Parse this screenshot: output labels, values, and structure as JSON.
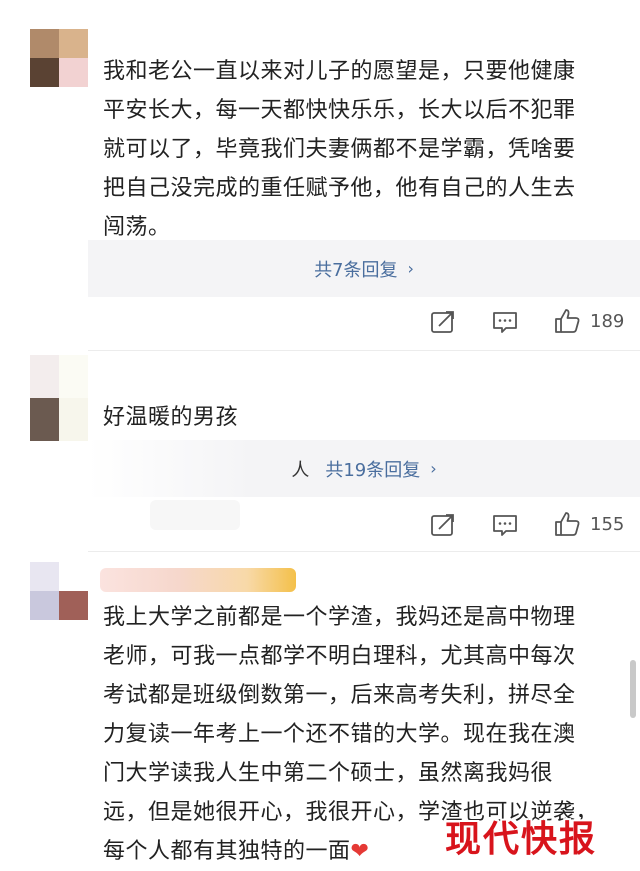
{
  "comments": [
    {
      "text": "我和老公一直以来对儿子的愿望是，只要他健康平安长大，每一天都快快乐乐，长大以后不犯罪就可以了，毕竟我们夫妻俩都不是学霸，凭啥要把自己没完成的重任赋予他，他有自己的人生去闯荡。",
      "lines": [
        "我和老公一直以来对儿子的愿望是，只要他健康",
        "平安长大，每一天都快快乐乐，长大以后不犯罪",
        "就可以了，毕竟我们夫妻俩都不是学霸，凭啥要",
        "把自己没完成的重任赋予他，他有自己的人生去",
        "闯荡。"
      ],
      "reply_label": "共7条回复",
      "likes": "189",
      "avatar_colors": [
        "#b08a6a",
        "#d9b38c",
        "#5a4233",
        "#f2d2d2"
      ]
    },
    {
      "text": "好温暖的男孩",
      "lines": [
        "好温暖的男孩"
      ],
      "reply_prefix": "人",
      "reply_label": "共19条回复",
      "likes": "155",
      "avatar_colors": [
        "#f3eded",
        "#fbfbf4",
        "#6b5a50",
        "#f7f6ec"
      ]
    },
    {
      "text": "我上大学之前都是一个学渣，我妈还是高中物理老师，可我一点都学不明白理科，尤其高中每次考试都是班级倒数第一，后来高考失利，拼尽全力复读一年考上一个还不错的大学。现在我在澳门大学读我人生中第二个硕士，虽然离我妈很远，但是她很开心，我很开心，学渣也可以逆袭，每个人都有其独特的一面",
      "lines": [
        "我上大学之前都是一个学渣，我妈还是高中物理",
        "老师，可我一点都学不明白理科，尤其高中每次",
        "考试都是班级倒数第一，后来高考失利，拼尽全",
        "力复读一年考上一个还不错的大学。现在我在澳",
        "门大学读我人生中第二个硕士，虽然离我妈很",
        "远，但是她很开心，我很开心，学渣也可以逆袭，",
        "每个人都有其独特的一面"
      ],
      "heart": "❤",
      "avatar_colors": [
        "#e8e6f1",
        "#ffffff",
        "#c9c8dd",
        "#a06058"
      ]
    }
  ],
  "watermark": "现代快报",
  "colors": {
    "link": "#4a6e9e",
    "reply_bg": "#f4f4f6",
    "watermark": "#d8141c"
  },
  "icons": [
    "share-icon",
    "comment-icon",
    "like-icon"
  ]
}
